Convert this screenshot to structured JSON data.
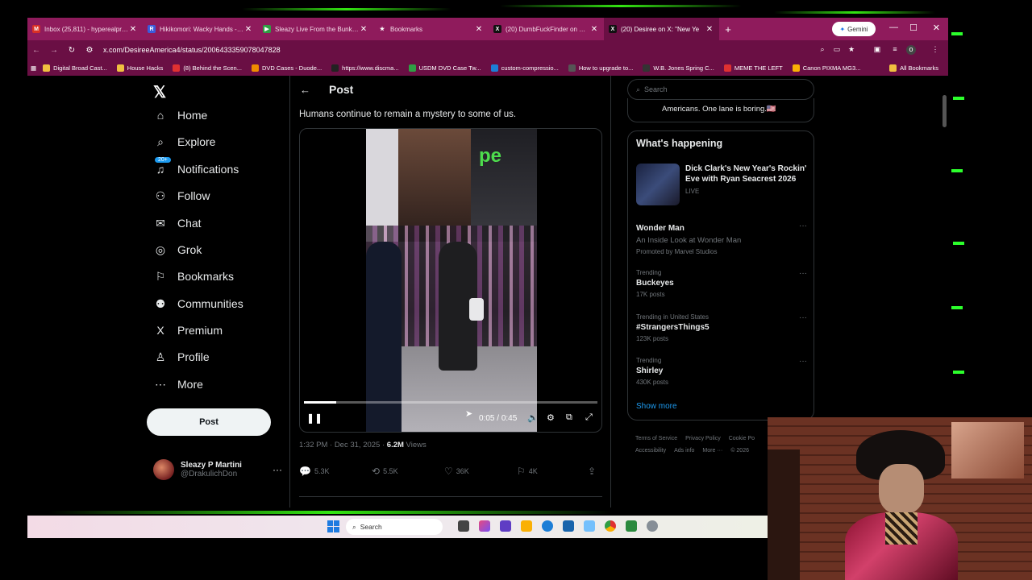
{
  "browser": {
    "tabs": [
      {
        "title": "Inbox (25,811) - hyperealprodu",
        "fav": "M",
        "color": "#d93025",
        "active": false
      },
      {
        "title": "Hikikomori: Wacky Hands - Re",
        "fav": "R",
        "color": "#3b5bdb",
        "active": false
      },
      {
        "title": "Sleazy Live From the Bunker 12",
        "fav": "▶",
        "color": "#2f9e44",
        "active": false
      },
      {
        "title": "Bookmarks",
        "fav": "★",
        "color": "#8f1b5c",
        "active": false
      },
      {
        "title": "(20) DumbFuckFinder on X: \"N",
        "fav": "X",
        "color": "#111111",
        "active": false
      },
      {
        "title": "(20) Desiree on X: \"New Ye",
        "fav": "X",
        "color": "#111111",
        "active": true
      }
    ],
    "new_tab": "+",
    "gemini_label": "Gemini",
    "url": "x.com/DesireeAmerica4/status/2006433359078047828",
    "bookmarks": [
      {
        "label": "Digital Broad Cast...",
        "color": "#f0c040"
      },
      {
        "label": "House Hacks",
        "color": "#f0c040"
      },
      {
        "label": "(8) Behind the Scen...",
        "color": "#e03131"
      },
      {
        "label": "DVD Cases - Duode...",
        "color": "#f08c00"
      },
      {
        "label": "https://www.discma...",
        "color": "#222222"
      },
      {
        "label": "USDM DVD Case Tw...",
        "color": "#2f9e44"
      },
      {
        "label": "custom-compressio...",
        "color": "#1c7ed6"
      },
      {
        "label": "How to upgrade to...",
        "color": "#555555"
      },
      {
        "label": "W.B. Jones Spring C...",
        "color": "#333333"
      },
      {
        "label": "MEME THE LEFT",
        "color": "#e03131"
      },
      {
        "label": "Canon PIXMA MG3...",
        "color": "#fab005"
      }
    ],
    "all_bookmarks": "All Bookmarks"
  },
  "nav": {
    "items": [
      {
        "label": "Home",
        "icon": "⌂"
      },
      {
        "label": "Explore",
        "icon": "⌕"
      },
      {
        "label": "Notifications",
        "icon": "♫"
      },
      {
        "label": "Follow",
        "icon": "⚇"
      },
      {
        "label": "Chat",
        "icon": "✉"
      },
      {
        "label": "Grok",
        "icon": "◎"
      },
      {
        "label": "Bookmarks",
        "icon": "⚐"
      },
      {
        "label": "Communities",
        "icon": "⚉"
      },
      {
        "label": "Premium",
        "icon": "X"
      },
      {
        "label": "Profile",
        "icon": "♙"
      },
      {
        "label": "More",
        "icon": "⋯"
      }
    ],
    "notif_badge": "20+",
    "post_button": "Post",
    "account": {
      "name": "Sleazy P Martini",
      "handle": "@DrakulichDon"
    }
  },
  "post": {
    "header": "Post",
    "text": "Humans continue to remain a mystery to some of us.",
    "video": {
      "elapsed": "0:05",
      "total": "0:45",
      "progress": 0.11
    },
    "timestamp": "1:32 PM · Dec 31, 2025 · ",
    "views_count": "6.2M",
    "views_label": " Views",
    "replies": "5.3K",
    "reposts": "5.5K",
    "likes": "36K",
    "bookmarks": "4K"
  },
  "sidebar": {
    "search_placeholder": "Search",
    "prev_card_text": "Americans. One lane is boring.🇺🇸",
    "whats_happening": "What's happening",
    "live": {
      "title": "Dick Clark's New Year's Rockin' Eve with Ryan Seacrest 2026",
      "tag": "LIVE"
    },
    "trends": [
      {
        "category": "",
        "name": "Wonder Man",
        "subtitle": "An Inside Look at Wonder Man",
        "count": "Promoted by Marvel Studios"
      },
      {
        "category": "Trending",
        "name": "Buckeyes",
        "subtitle": "",
        "count": "17K posts"
      },
      {
        "category": "Trending in United States",
        "name": "#StrangersThings5",
        "subtitle": "",
        "count": "123K posts"
      },
      {
        "category": "Trending",
        "name": "Shirley",
        "subtitle": "",
        "count": "430K posts"
      }
    ],
    "show_more": "Show more",
    "footer": [
      "Terms of Service",
      "Privacy Policy",
      "Cookie Po",
      "Accessibility",
      "Ads info",
      "More ···",
      "© 2026"
    ]
  },
  "taskbar": {
    "search": "Search"
  }
}
